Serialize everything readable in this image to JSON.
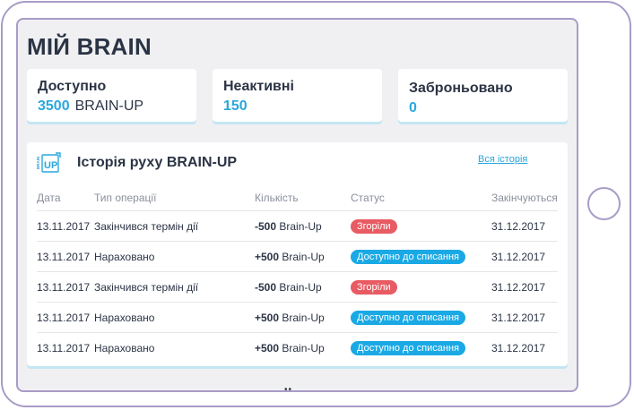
{
  "page": {
    "title": "МІЙ BRAIN"
  },
  "stats": {
    "available": {
      "label": "Доступно",
      "value": "3500",
      "unit": "BRAIN-UP"
    },
    "inactive": {
      "label": "Неактивні",
      "value": "150"
    },
    "reserved": {
      "label": "Заброньовано",
      "value": "0"
    }
  },
  "history": {
    "logo_text": "BRAIN UP",
    "title": "Історія руху BRAIN-UP",
    "all_link": "Вся історія",
    "columns": {
      "date": "Дата",
      "type": "Тип операції",
      "amount": "Кількість",
      "status": "Статус",
      "expires": "Закінчуються"
    },
    "rows": [
      {
        "date": "13.11.2017",
        "type": "Закінчився термін дії",
        "amount": "-500",
        "unit": "Brain-Up",
        "status": "Згоріли",
        "expires": "31.12.2017"
      },
      {
        "date": "13.11.2017",
        "type": "Нараховано",
        "amount": "+500",
        "unit": "Brain-Up",
        "status": "Доступно до списання",
        "expires": "31.12.2017"
      },
      {
        "date": "13.11.2017",
        "type": "Закінчився термін дії",
        "amount": "-500",
        "unit": "Brain-Up",
        "status": "Згоріли",
        "expires": "31.12.2017"
      },
      {
        "date": "13.11.2017",
        "type": "Нараховано",
        "amount": "+500",
        "unit": "Brain-Up",
        "status": "Доступно до списання",
        "expires": "31.12.2017"
      },
      {
        "date": "13.11.2017",
        "type": "Нараховано",
        "amount": "+500",
        "unit": "Brain-Up",
        "status": "Доступно до списання",
        "expires": "31.12.2017"
      }
    ]
  },
  "colors": {
    "accent": "#2aa7dc",
    "badge_burned": "#e85b63",
    "badge_available": "#1aa9e4",
    "text_dark": "#2b3445",
    "device_frame": "#a89cc8"
  },
  "icons": {
    "logo": "brain-up-logo-icon",
    "home": "home-button"
  }
}
